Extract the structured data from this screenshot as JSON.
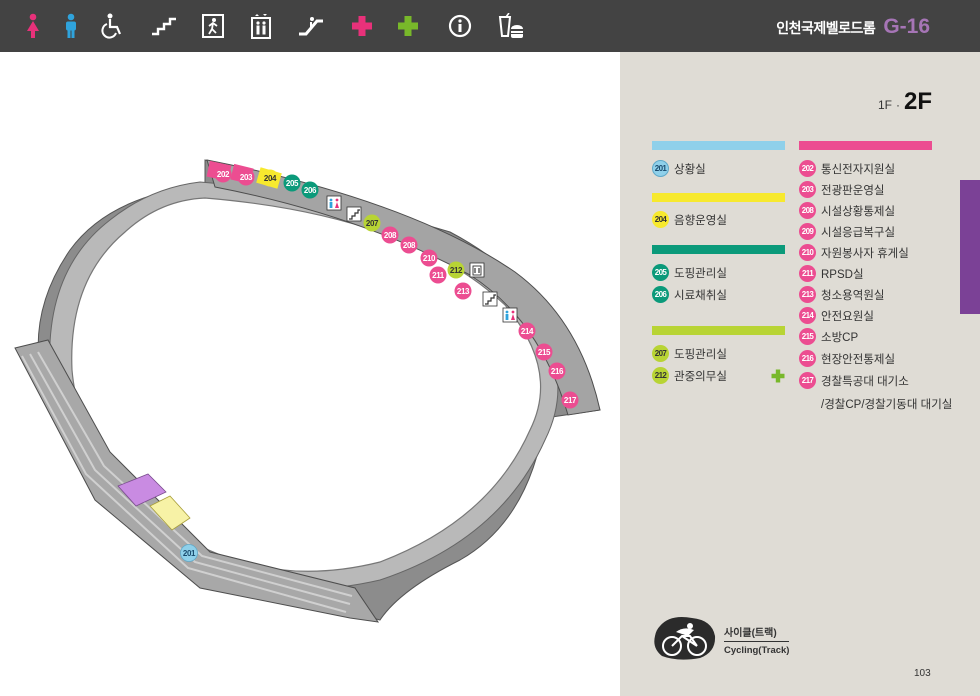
{
  "header": {
    "icons": [
      {
        "name": "female-restroom-icon",
        "color": "#e8317a"
      },
      {
        "name": "male-restroom-icon",
        "color": "#2fa3dc"
      },
      {
        "name": "wheelchair-icon",
        "color": "#ffffff"
      },
      {
        "name": "stairs-icon",
        "color": "#ffffff"
      },
      {
        "name": "emergency-exit-icon",
        "color": "#ffffff"
      },
      {
        "name": "elevator-icon",
        "color": "#ffffff"
      },
      {
        "name": "escalator-icon",
        "color": "#ffffff"
      },
      {
        "name": "first-aid-pink-icon",
        "color": "#e8317a"
      },
      {
        "name": "first-aid-green-icon",
        "color": "#78b82a"
      },
      {
        "name": "information-icon",
        "color": "#ffffff"
      },
      {
        "name": "food-drink-icon",
        "color": "#ffffff"
      }
    ],
    "venue_name": "인천국제벨로드롬",
    "venue_code": "G-16"
  },
  "floor": {
    "first": "1F",
    "separator": "·",
    "current": "2F"
  },
  "legend": {
    "left": [
      {
        "bar_color": "#8fd0ea",
        "items": [
          {
            "num": "201",
            "label": "상황실",
            "style": "blue"
          }
        ]
      },
      {
        "bar_color": "#f7e92e",
        "items": [
          {
            "num": "204",
            "label": "음향운영실",
            "style": "yellow"
          }
        ]
      },
      {
        "bar_color": "#0b9a7a",
        "items": [
          {
            "num": "205",
            "label": "도핑관리실",
            "style": "green"
          },
          {
            "num": "206",
            "label": "시료채취실",
            "style": "green"
          }
        ]
      },
      {
        "bar_color": "#b8d434",
        "items": [
          {
            "num": "207",
            "label": "도핑관리실",
            "style": "lime"
          },
          {
            "num": "212",
            "label": "관중의무실",
            "style": "lime"
          }
        ]
      }
    ],
    "right": {
      "bar_color": "#ec4d91",
      "items": [
        {
          "num": "202",
          "label": "통신전자지원실"
        },
        {
          "num": "203",
          "label": "전광판운영실"
        },
        {
          "num": "208",
          "label": "시설상황통제실"
        },
        {
          "num": "209",
          "label": "시설응급복구실"
        },
        {
          "num": "210",
          "label": "자원봉사자 휴게실"
        },
        {
          "num": "211",
          "label": "RPSD실"
        },
        {
          "num": "213",
          "label": "청소용역원실"
        },
        {
          "num": "214",
          "label": "안전요원실"
        },
        {
          "num": "215",
          "label": "소방CP"
        },
        {
          "num": "216",
          "label": "현장안전통제실"
        },
        {
          "num": "217",
          "label": "경찰특공대 대기소"
        }
      ],
      "continuation": "/경찰CP/경찰기동대 대기실"
    },
    "first_aid_icon": "first-aid-green-icon"
  },
  "map": {
    "labels": [
      {
        "num": "202",
        "style": "pink"
      },
      {
        "num": "203",
        "style": "pink"
      },
      {
        "num": "204",
        "style": "yellow"
      },
      {
        "num": "205",
        "style": "green"
      },
      {
        "num": "206",
        "style": "green"
      },
      {
        "num": "207",
        "style": "lime"
      },
      {
        "num": "208",
        "style": "pink"
      },
      {
        "num": "208",
        "style": "pink"
      },
      {
        "num": "210",
        "style": "pink"
      },
      {
        "num": "211",
        "style": "pink"
      },
      {
        "num": "212",
        "style": "lime"
      },
      {
        "num": "213",
        "style": "pink"
      },
      {
        "num": "214",
        "style": "pink"
      },
      {
        "num": "215",
        "style": "pink"
      },
      {
        "num": "216",
        "style": "pink"
      },
      {
        "num": "217",
        "style": "pink"
      },
      {
        "num": "201",
        "style": "blue"
      }
    ],
    "map_icons": [
      "restroom-icon",
      "stairs-icon",
      "elevator-icon",
      "stairs-icon",
      "restroom-icon"
    ]
  },
  "cycling": {
    "label_ko": "사이클(트랙)",
    "label_en": "Cycling(Track)",
    "icon": "cyclist-icon"
  },
  "page_number": "103"
}
